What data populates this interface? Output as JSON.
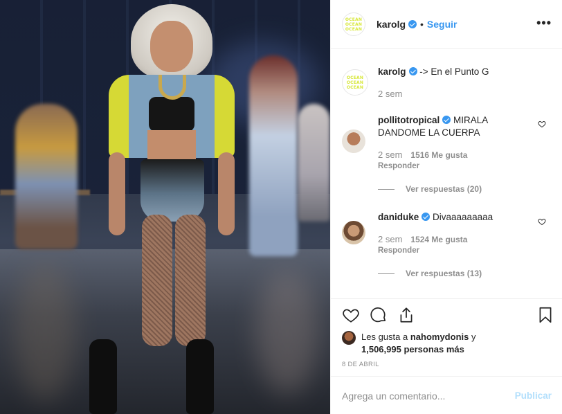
{
  "post": {
    "author": "karolg",
    "follow_label": "Seguir",
    "more_label": "•••",
    "avatar_text": [
      "OCEAN",
      "OCEAN",
      "OCEAN"
    ]
  },
  "caption": {
    "username": "karolg",
    "text": "-> En el Punto G",
    "time": "2 sem"
  },
  "comments": [
    {
      "username": "pollitotropical",
      "text": "MIRALA DANDOME LA CUERPA",
      "time": "2 sem",
      "likes": "1516 Me gusta",
      "reply_label": "Responder",
      "view_replies": "Ver respuestas (20)"
    },
    {
      "username": "daniduke",
      "text": "Divaaaaaaaaa",
      "time": "2 sem",
      "likes": "1524 Me gusta",
      "reply_label": "Responder",
      "view_replies": "Ver respuestas (13)"
    }
  ],
  "likes": {
    "prefix": "Les gusta a",
    "user": "nahomydonis",
    "connector": "y",
    "count": "1,506,995 personas más"
  },
  "date": "8 DE ABRIL",
  "comment_box": {
    "placeholder": "Agrega un comentario...",
    "publish_label": "Publicar"
  },
  "icons": {
    "like": "heart-icon",
    "comment": "comment-icon",
    "share": "share-icon",
    "save": "bookmark-icon",
    "verified": "verified-badge-icon"
  },
  "colors": {
    "accent": "#3897f0",
    "publish_disabled": "#b2dffc",
    "muted": "#8e8e8e",
    "text": "#262626",
    "border": "#efefef"
  }
}
